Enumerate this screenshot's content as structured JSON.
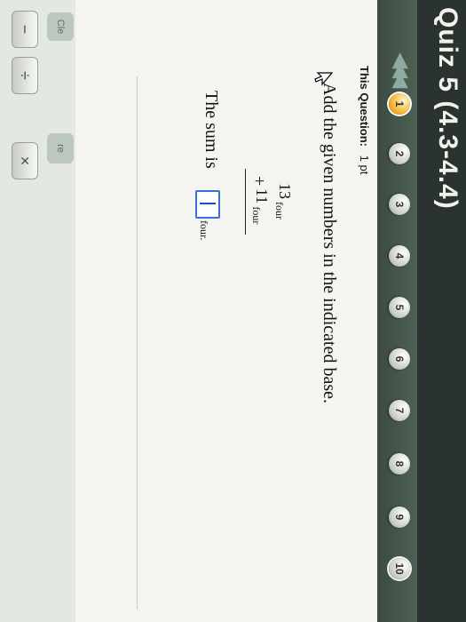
{
  "quiz_title": "Quiz 5 (4.3-4.4)",
  "nav": {
    "prev_arrows": "◀◀ ◀",
    "questions": [
      "1",
      "2",
      "3",
      "4",
      "5",
      "6",
      "7",
      "8",
      "9",
      "10"
    ],
    "current": "1"
  },
  "question": {
    "header_label": "This Question:",
    "points": "1 pt",
    "instruction": "Add the given numbers in the indicated base.",
    "addend1": "13",
    "addend2": "11",
    "base": "four",
    "operator": "+",
    "sum_label": "The sum is",
    "answer_value": "",
    "answer_base": "four",
    "period": "."
  },
  "tools": {
    "minus": "−",
    "divide": "÷",
    "times": "×",
    "side_label_1": "Cle",
    "side_label_2": "re"
  },
  "colors": {
    "header_bg": "#2a332f",
    "nav_bg": "#4f6055",
    "current_question": "#f3b531",
    "answer_box_border": "#3b6fd1"
  }
}
